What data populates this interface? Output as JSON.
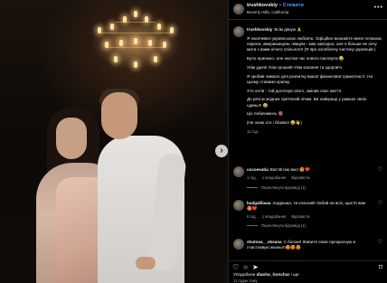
{
  "post": {
    "username": "trushkovskiy",
    "separator": "•",
    "follow_label": "Стежити",
    "location": "Beverly Hills, California",
    "more_label": "•••"
  },
  "caption": {
    "username": "trushkovskiy",
    "first_line": "Всім дякую 🙏",
    "paragraphs": [
      "Я насичився українською любов'ю. Офіційно визнаю́те мене псяжком, євреєм, американцем, німцем - ким завгодно, але я більше не хочу мати з вами нічого спільного! (Я про озлоблену частину українців.)",
      "Було приємно, але настав час нового паспорта 😂",
      "Усім удачі! Усім грошей! Усім кохання та здоров'я.",
      "Я зробив чимало для розвитку вашої фінансової грамотності. На цьому ставимо крапку.",
      "Хто хотів - той досягнув свого, змінив своє життя.",
      "До речі,м жодних претензій нічим. Ви найкращі у рамках своїх єдинь!!! 😂",
      "Ціє побачимось 🔞",
      "(Не знаю хто і бісився 😂👋)"
    ],
    "time": "11 год."
  },
  "comments": [
    {
      "username": "cocoesatia",
      "text": "Ваї! Вітаю вас! 😍❤️",
      "time": "1 год.",
      "likes": "1 вподобання",
      "reply": "Відповісти",
      "replies": "Переглянути відповіді (1)"
    },
    {
      "username": "badgalliiaaa",
      "text": "Андрюша, ти класний! Забий на всіх, щастя вам 😍❤️",
      "time": "6 год.",
      "likes": "1 вподобання",
      "reply": "Відповісти",
      "replies": "Переглянути відповіді (1)"
    },
    {
      "username": "shutova__oksana",
      "text": "С богом!! Живите свою прекрасную и счастливую жизнь!!!😍😍😍",
      "time": "",
      "likes": "",
      "reply": "",
      "replies": ""
    }
  ],
  "footer": {
    "liked_prefix": "Уподобали",
    "liked_by": "diasha_honchar",
    "liked_suffix": "і ще",
    "time": "11 годин тому"
  },
  "icons": {
    "heart": "♡",
    "comment": "○",
    "share": "➤",
    "bookmark": "⌑",
    "next": "›"
  }
}
